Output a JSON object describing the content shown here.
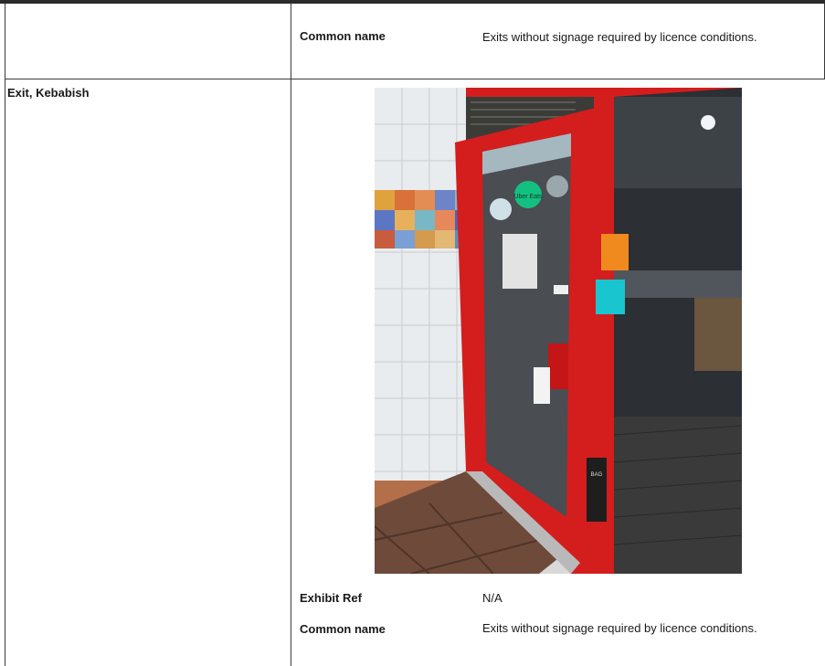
{
  "table": {
    "top_row": {
      "label": "Common name",
      "value": "Exits without signage required by licence conditions."
    },
    "section": {
      "title": "Exit, Kebabish",
      "photo": {
        "sticker_text": "Uber Eats",
        "bag_text": "BAG"
      },
      "fields": [
        {
          "label": "Exhibit Ref",
          "value": "N/A"
        },
        {
          "label": "Common name",
          "value": "Exits without signage required by licence conditions."
        }
      ]
    }
  }
}
